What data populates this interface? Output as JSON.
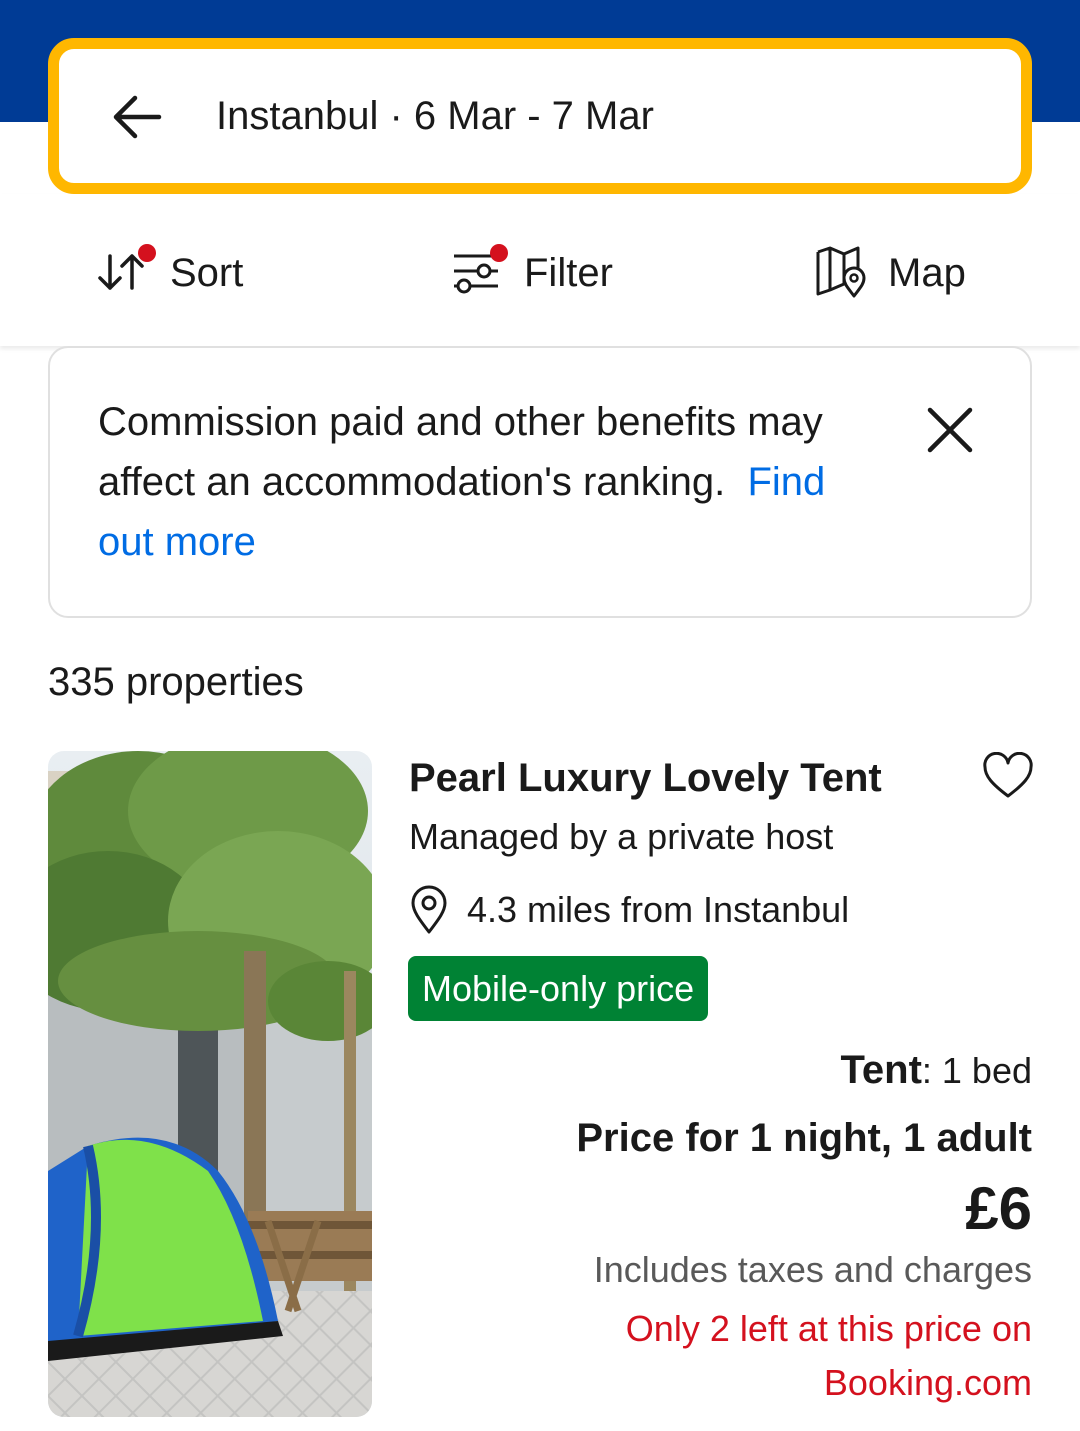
{
  "search": {
    "summary": "Instanbul · 6 Mar - 7 Mar"
  },
  "actions": {
    "sort_label": "Sort",
    "filter_label": "Filter",
    "map_label": "Map"
  },
  "notice": {
    "text": "Commission paid and other benefits may affect an accommodation's ranking.",
    "link": "Find out more"
  },
  "results": {
    "count_label": "335 properties"
  },
  "property": {
    "name": "Pearl Luxury Lovely Tent",
    "host": "Managed by a private host",
    "distance": "4.3 miles from Instanbul",
    "badge": "Mobile-only price",
    "room_type": "Tent",
    "room_detail": ": 1 bed",
    "price_context": "Price for 1 night, 1 adult",
    "price": "£6",
    "taxes": "Includes taxes and charges",
    "scarcity_line1": "Only 2 left at this price on",
    "scarcity_line2": "Booking.com"
  },
  "colors": {
    "brand_blue": "#003b95",
    "search_border": "#ffb700",
    "link_blue": "#006ce4",
    "badge_green": "#008234",
    "alert_red": "#d4111e"
  },
  "icons": {
    "back": "arrow-left-icon",
    "sort": "sort-arrows-icon",
    "filter": "sliders-icon",
    "map": "map-pin-icon",
    "close": "close-icon",
    "favorite": "heart-outline-icon",
    "location": "location-pin-icon"
  }
}
